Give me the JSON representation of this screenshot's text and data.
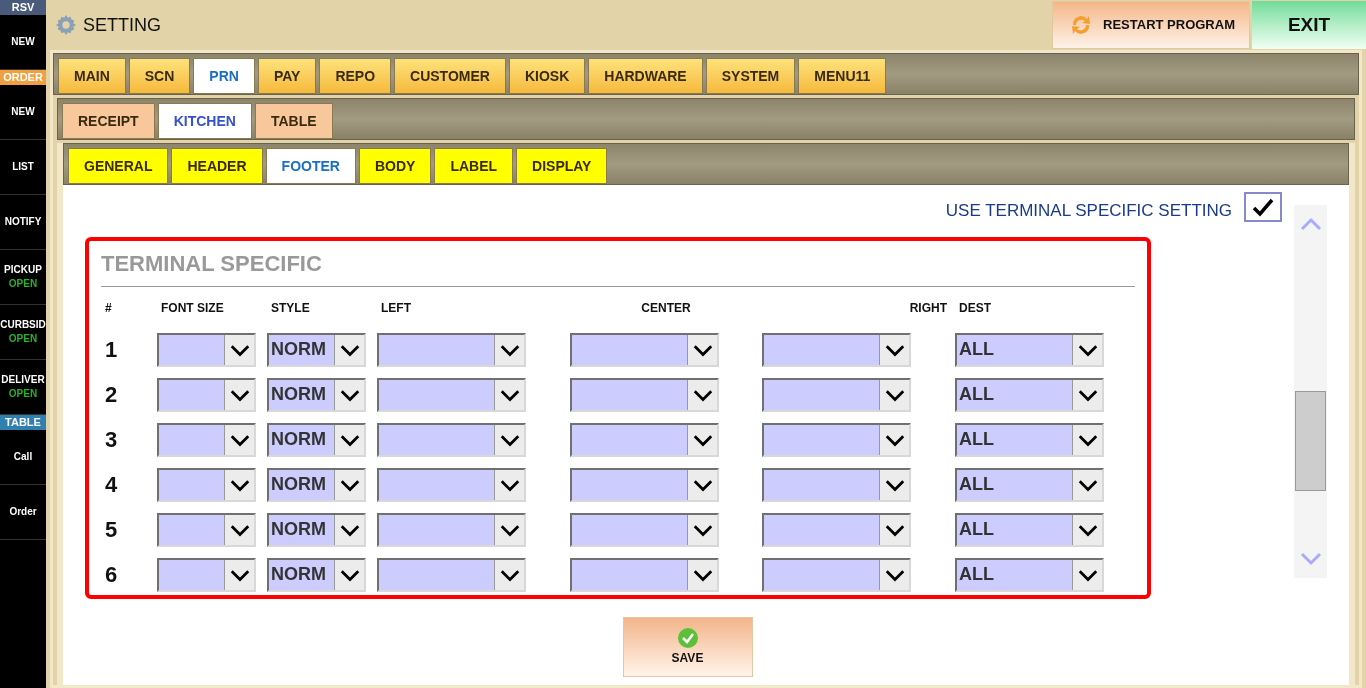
{
  "sidebar": [
    {
      "kind": "header",
      "label": "RSV",
      "color": "#4a5a7a"
    },
    {
      "kind": "button",
      "label": "NEW"
    },
    {
      "kind": "header",
      "label": "ORDER",
      "color": "#f0a040"
    },
    {
      "kind": "button",
      "label": "NEW"
    },
    {
      "kind": "button",
      "label": "LIST"
    },
    {
      "kind": "button",
      "label": "NOTIFY"
    },
    {
      "kind": "button",
      "label": "PICKUP",
      "status": "OPEN"
    },
    {
      "kind": "button",
      "label": "CURBSID",
      "status": "OPEN"
    },
    {
      "kind": "button",
      "label": "DELIVER",
      "status": "OPEN"
    },
    {
      "kind": "header",
      "label": "TABLE",
      "color": "#2f7fb0"
    },
    {
      "kind": "button",
      "label": "Call"
    },
    {
      "kind": "button",
      "label": "Order"
    }
  ],
  "header": {
    "title": "SETTING",
    "restart_button": "RESTART PROGRAM",
    "exit_button": "EXIT"
  },
  "tabs": [
    {
      "label": "MAIN",
      "selected": false
    },
    {
      "label": "SCN",
      "selected": false
    },
    {
      "label": "PRN",
      "selected": true
    },
    {
      "label": "PAY",
      "selected": false
    },
    {
      "label": "REPO",
      "selected": false
    },
    {
      "label": "CUSTOMER",
      "selected": false
    },
    {
      "label": "KIOSK",
      "selected": false
    },
    {
      "label": "HARDWARE",
      "selected": false
    },
    {
      "label": "SYSTEM",
      "selected": false
    },
    {
      "label": "MENU11",
      "selected": false
    }
  ],
  "subtabs": [
    {
      "label": "RECEIPT",
      "selected": false
    },
    {
      "label": "KITCHEN",
      "selected": true
    },
    {
      "label": "TABLE",
      "selected": false
    }
  ],
  "section_tabs": [
    {
      "label": "GENERAL",
      "selected": false
    },
    {
      "label": "HEADER",
      "selected": false
    },
    {
      "label": "FOOTER",
      "selected": true
    },
    {
      "label": "BODY",
      "selected": false
    },
    {
      "label": "LABEL",
      "selected": false
    },
    {
      "label": "DISPLAY",
      "selected": false
    }
  ],
  "use_terminal_specific": {
    "label": "USE TERMINAL SPECIFIC SETTING",
    "checked": true
  },
  "panel": {
    "title": "TERMINAL SPECIFIC",
    "columns": [
      "#",
      "FONT SIZE",
      "STYLE",
      "LEFT",
      "CENTER",
      "RIGHT",
      "DEST"
    ],
    "rows": [
      {
        "number": "1",
        "style": "NORM",
        "dest": "ALL"
      },
      {
        "number": "2",
        "style": "NORM",
        "dest": "ALL"
      },
      {
        "number": "3",
        "style": "NORM",
        "dest": "ALL"
      },
      {
        "number": "4",
        "style": "NORM",
        "dest": "ALL"
      },
      {
        "number": "5",
        "style": "NORM",
        "dest": "ALL"
      },
      {
        "number": "6",
        "style": "NORM",
        "dest": "ALL"
      }
    ]
  },
  "save_button": "SAVE"
}
